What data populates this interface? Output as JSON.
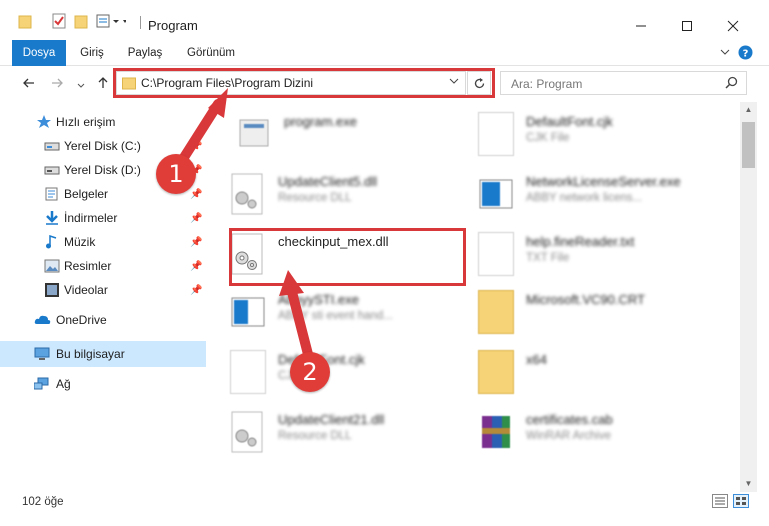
{
  "window": {
    "title": "Program",
    "minimize_icon": "minimize-icon",
    "maximize_icon": "maximize-icon",
    "close_icon": "close-icon"
  },
  "ribbon": {
    "tabs": [
      {
        "label": "Dosya"
      },
      {
        "label": "Giriş"
      },
      {
        "label": "Paylaş"
      },
      {
        "label": "Görünüm"
      }
    ]
  },
  "address": {
    "path": "C:\\Program Files\\Program Dizini"
  },
  "search": {
    "placeholder": "Ara: Program"
  },
  "nav": {
    "items": [
      {
        "label": "Hızlı erişim",
        "icon": "star-icon"
      },
      {
        "label": "Yerel Disk (C:)",
        "icon": "drive-icon"
      },
      {
        "label": "Yerel Disk (D:)",
        "icon": "drive-icon"
      },
      {
        "label": "Belgeler",
        "icon": "documents-icon"
      },
      {
        "label": "İndirmeler",
        "icon": "downloads-icon"
      },
      {
        "label": "Müzik",
        "icon": "music-icon"
      },
      {
        "label": "Resimler",
        "icon": "pictures-icon"
      },
      {
        "label": "Videolar",
        "icon": "videos-icon"
      },
      {
        "label": "OneDrive",
        "icon": "cloud-icon"
      },
      {
        "label": "Bu bilgisayar",
        "icon": "computer-icon"
      },
      {
        "label": "Ağ",
        "icon": "network-icon"
      }
    ]
  },
  "files": [
    {
      "name": "program.exe",
      "sub": ""
    },
    {
      "name": "DefaultFont.cjk",
      "sub": "CJK File"
    },
    {
      "name": "UpdateClient5.dll",
      "sub": "Resource DLL"
    },
    {
      "name": "NetworkLicenseServer.exe",
      "sub": "ABBY network licens..."
    },
    {
      "name": "checkinput_mex.dll",
      "sub": ""
    },
    {
      "name": "help.fineReader.txt",
      "sub": "TXT File"
    },
    {
      "name": "AbbyySTI.exe",
      "sub": "ABBY sti event hand..."
    },
    {
      "name": "Microsoft.VC90.CRT",
      "sub": ""
    },
    {
      "name": "DefaultFont.cjk",
      "sub": "CJK File"
    },
    {
      "name": "x64",
      "sub": ""
    },
    {
      "name": "UpdateClient21.dll",
      "sub": "Resource DLL"
    },
    {
      "name": "certificates.cab",
      "sub": "WinRAR Archive"
    }
  ],
  "status": {
    "count": "102 öğe"
  },
  "annotations": {
    "step1": "1",
    "step2": "2"
  },
  "colors": {
    "accent": "#1979ca",
    "highlight": "#d9383a",
    "selection": "#cce8ff"
  }
}
